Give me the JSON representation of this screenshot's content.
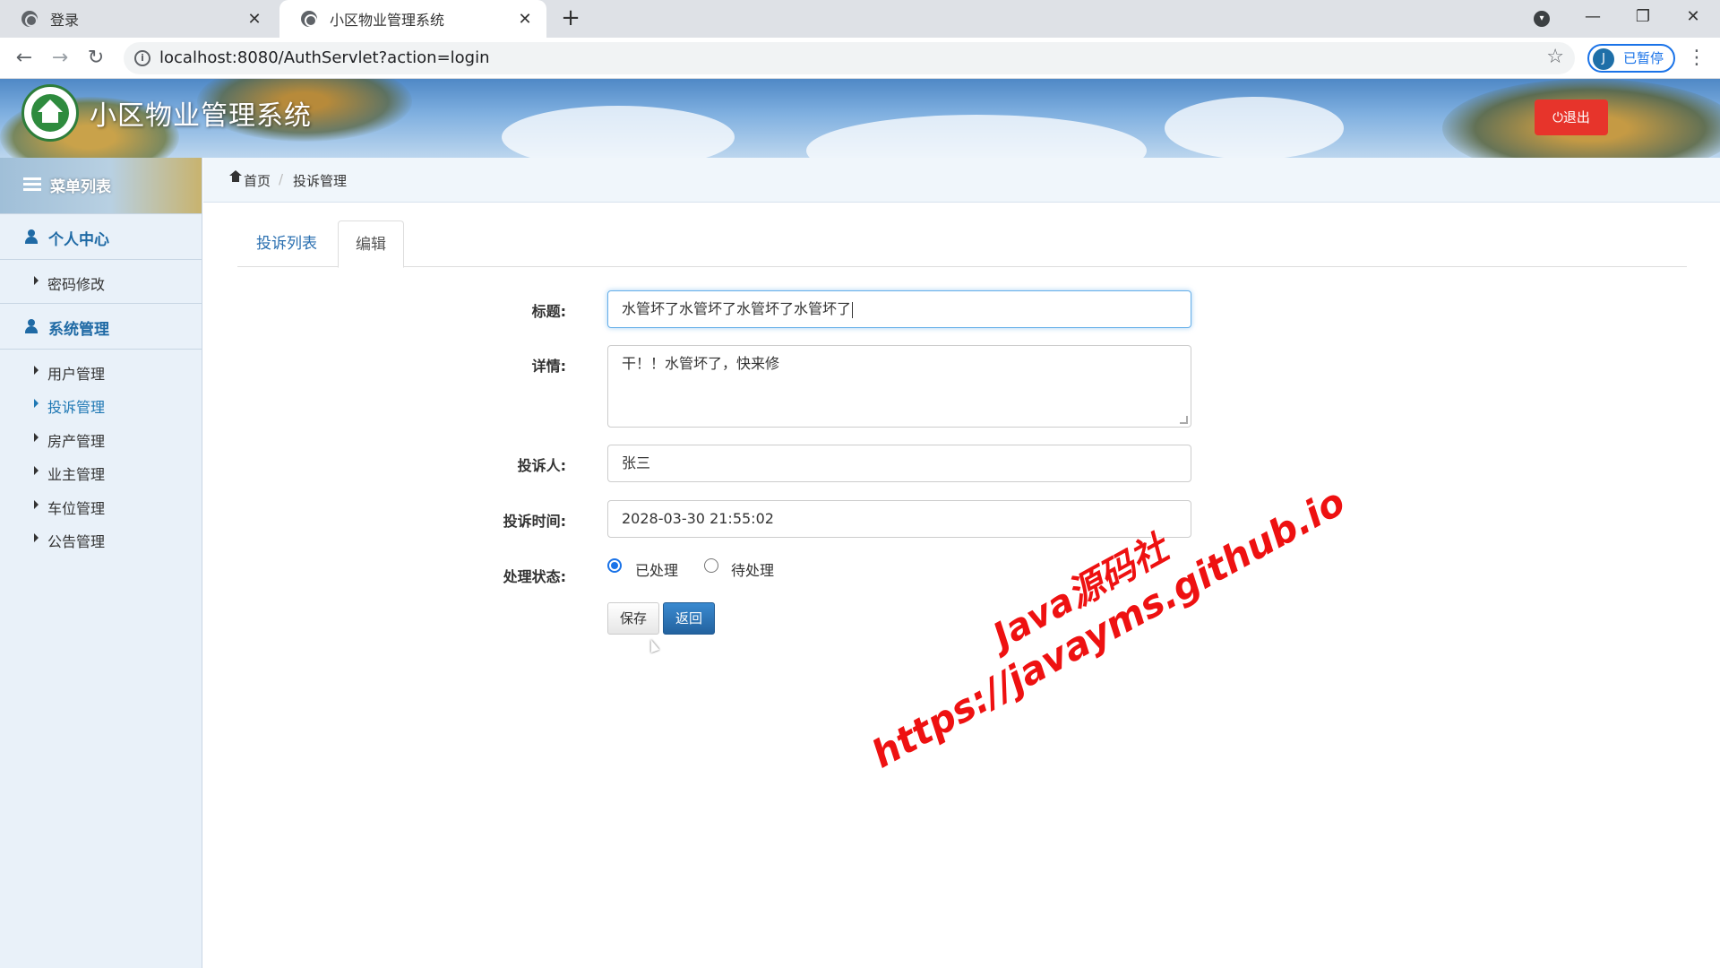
{
  "browser": {
    "tabs": [
      {
        "title": "登录",
        "active": false
      },
      {
        "title": "小区物业管理系统",
        "active": true
      }
    ],
    "new_tab": "+",
    "url": "localhost:8080/AuthServlet?action=login",
    "profile_initial": "J",
    "profile_status": "已暂停",
    "window_controls": {
      "minimize": "—",
      "restore": "❐",
      "close": "✕"
    }
  },
  "header": {
    "title": "小区物业管理系统",
    "logout_label": "⏻退出"
  },
  "sidebar": {
    "menu_title": "菜单列表",
    "groups": [
      {
        "label": "个人中心",
        "items": [
          {
            "label": "密码修改",
            "active": false
          }
        ]
      },
      {
        "label": "系统管理",
        "items": [
          {
            "label": "用户管理",
            "active": false
          },
          {
            "label": "投诉管理",
            "active": true
          },
          {
            "label": "房产管理",
            "active": false
          },
          {
            "label": "业主管理",
            "active": false
          },
          {
            "label": "车位管理",
            "active": false
          },
          {
            "label": "公告管理",
            "active": false
          }
        ]
      }
    ]
  },
  "breadcrumb": {
    "home": "首页",
    "separator": "/",
    "current": "投诉管理"
  },
  "tabs": {
    "list": "投诉列表",
    "edit": "编辑"
  },
  "form": {
    "title_label": "标题:",
    "title_value": "水管坏了水管坏了水管坏了水管坏了",
    "detail_label": "详情:",
    "detail_value": "干！！水管坏了，快来修",
    "complainant_label": "投诉人:",
    "complainant_value": "张三",
    "time_label": "投诉时间:",
    "time_value": "2028-03-30 21:55:02",
    "status_label": "处理状态:",
    "status_options": [
      {
        "label": "已处理",
        "selected": true
      },
      {
        "label": "待处理",
        "selected": false
      }
    ],
    "save_label": "保存",
    "back_label": "返回"
  },
  "watermark": {
    "line1": "Java源码社",
    "line2": "https://javayms.github.io"
  },
  "colors": {
    "accent": "#1f6aa5",
    "logout": "#e7342b",
    "back_button": "#2a73b8",
    "watermark": "#ee1111"
  },
  "icons": [
    "globe-icon",
    "close-icon",
    "plus-icon",
    "back-arrow-icon",
    "forward-arrow-icon",
    "reload-icon",
    "info-icon",
    "star-icon",
    "menu-list-icon",
    "user-icon",
    "caret-right-icon",
    "home-icon",
    "power-icon"
  ]
}
